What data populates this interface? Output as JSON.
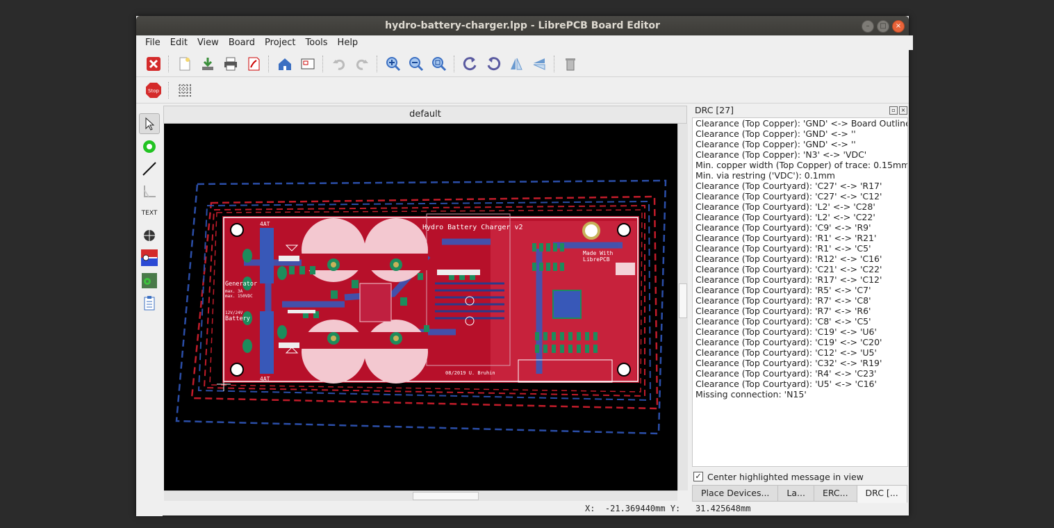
{
  "window": {
    "title": "hydro-battery-charger.lpp - LibrePCB Board Editor"
  },
  "menu": [
    "File",
    "Edit",
    "View",
    "Board",
    "Project",
    "Tools",
    "Help"
  ],
  "toolbar1": [
    "close-project-icon",
    "new-icon",
    "save-icon",
    "print-icon",
    "export-pdf-icon",
    "home-icon",
    "schematic-editor-icon",
    "undo-icon",
    "redo-icon",
    "zoom-in-icon",
    "zoom-out-icon",
    "zoom-fit-icon",
    "rotate-ccw-icon",
    "rotate-cw-icon",
    "flip-horizontal-icon",
    "flip-vertical-icon",
    "delete-icon"
  ],
  "toolbar2": [
    "stop-icon",
    "grid-icon"
  ],
  "tools": [
    "select-icon",
    "via-icon",
    "trace-icon",
    "polygon-icon",
    "text-icon",
    "hole-icon",
    "add-device-icon",
    "plane-icon",
    "checklist-icon"
  ],
  "tools_text_label": "TEXT",
  "board_tab": "default",
  "board": {
    "title_text": "Hydro Battery Charger v2",
    "made_with": "Made With",
    "librepcb": "LibrePCB",
    "generator": "Generator",
    "gen_spec1": "max. 3A",
    "gen_spec2": "max. 150VDC",
    "battery_spec": "12V/24V",
    "battery": "Battery",
    "date": "08/2019  U. Bruhin",
    "fuse_label": "4AT"
  },
  "drc": {
    "title": "DRC [27]",
    "messages": [
      "Clearance (Top Copper): 'GND' <-> Board Outline",
      "Clearance (Top Copper): 'GND' <-> ''",
      "Clearance (Top Copper): 'GND' <-> ''",
      "Clearance (Top Copper): 'N3' <-> 'VDC'",
      "Min. copper width (Top Copper) of trace: 0.15mm",
      "Min. via restring ('VDC'): 0.1mm",
      "Clearance (Top Courtyard): 'C27' <-> 'R17'",
      "Clearance (Top Courtyard): 'C27' <-> 'C12'",
      "Clearance (Top Courtyard): 'L2' <-> 'C28'",
      "Clearance (Top Courtyard): 'L2' <-> 'C22'",
      "Clearance (Top Courtyard): 'C9' <-> 'R9'",
      "Clearance (Top Courtyard): 'R1' <-> 'R21'",
      "Clearance (Top Courtyard): 'R1' <-> 'C5'",
      "Clearance (Top Courtyard): 'R12' <-> 'C16'",
      "Clearance (Top Courtyard): 'C21' <-> 'C22'",
      "Clearance (Top Courtyard): 'R17' <-> 'C12'",
      "Clearance (Top Courtyard): 'R5' <-> 'C7'",
      "Clearance (Top Courtyard): 'R7' <-> 'C8'",
      "Clearance (Top Courtyard): 'R7' <-> 'R6'",
      "Clearance (Top Courtyard): 'C8' <-> 'C5'",
      "Clearance (Top Courtyard): 'C19' <-> 'U6'",
      "Clearance (Top Courtyard): 'C19' <-> 'C20'",
      "Clearance (Top Courtyard): 'C12' <-> 'U5'",
      "Clearance (Top Courtyard): 'C32' <-> 'R19'",
      "Clearance (Top Courtyard): 'R4' <-> 'C23'",
      "Clearance (Top Courtyard): 'U5' <-> 'C16'",
      "Missing connection: 'N15'"
    ],
    "center_label": "Center highlighted message in view",
    "center_checked": "✓",
    "tabs": [
      "Place Devices...",
      "La...",
      "ERC...",
      "DRC [..."
    ]
  },
  "status": {
    "coords": "X:  -21.369440mm Y:   31.425648mm"
  }
}
